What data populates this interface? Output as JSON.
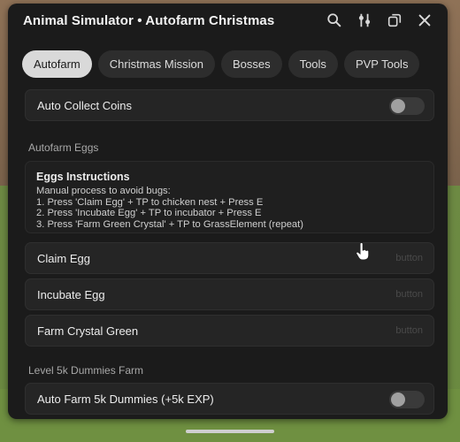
{
  "window": {
    "title": "Animal Simulator • Autofarm Christmas",
    "icons": [
      "search-icon",
      "settings-sliders-icon",
      "minimize-window-icon",
      "close-icon"
    ]
  },
  "tabs": [
    {
      "label": "Autofarm",
      "active": true
    },
    {
      "label": "Christmas Mission",
      "active": false
    },
    {
      "label": "Bosses",
      "active": false
    },
    {
      "label": "Tools",
      "active": false
    },
    {
      "label": "PVP Tools",
      "active": false
    }
  ],
  "content": {
    "auto_collect_coins": {
      "label": "Auto Collect Coins",
      "enabled": false
    },
    "section_eggs": "Autofarm Eggs",
    "instructions": {
      "title": "Eggs Instructions",
      "lines": [
        "Manual process to avoid bugs:",
        "1. Press 'Claim Egg' + TP to chicken nest + Press E",
        "2. Press 'Incubate Egg' + TP to incubator + Press E",
        "3. Press 'Farm Green Crystal' + TP to GrassElement (repeat)"
      ]
    },
    "buttons": [
      {
        "label": "Claim Egg",
        "hint": "button"
      },
      {
        "label": "Incubate Egg",
        "hint": "button"
      },
      {
        "label": "Farm Crystal Green",
        "hint": "button"
      }
    ],
    "section_dummies": "Level 5k Dummies Farm",
    "auto_farm_dummies": {
      "label": "Auto Farm 5k Dummies (+5k EXP)",
      "enabled": false
    }
  },
  "colors": {
    "window_bg": "#1b1b1b",
    "row_bg": "#252525",
    "tab_active": "#d9d9d9"
  }
}
